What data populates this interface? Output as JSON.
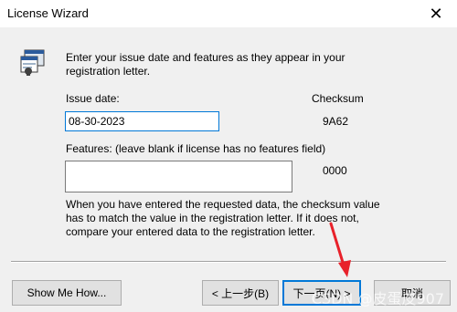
{
  "window": {
    "title": "License Wizard",
    "close_glyph": "✕"
  },
  "instruction": "Enter your issue date and features as they appear in your registration letter.",
  "issue_date": {
    "label": "Issue date:",
    "value": "08-30-2023"
  },
  "checksum": {
    "label": "Checksum",
    "issue_value": "9A62",
    "features_value": "0000"
  },
  "features": {
    "label": "Features: (leave blank if license has no features field)",
    "value": ""
  },
  "note": "When you have entered the requested data, the checksum value has to match the value in the registration letter.  If it does not, compare your entered data to the registration letter.",
  "buttons": {
    "show_me": "Show Me How...",
    "back": "< 上一步(B)",
    "next": "下一页(N) >",
    "cancel": "取消"
  },
  "watermark": "CSDN @皮蛋皮907",
  "annotation": {
    "arrow_color": "#e8212a"
  },
  "colors": {
    "focus_accent": "#0078d7",
    "window_bg": "#f0f0f0"
  },
  "icons": {
    "app": "license-wizard-icon",
    "close": "close-icon",
    "annotation": "red-arrow-icon"
  }
}
